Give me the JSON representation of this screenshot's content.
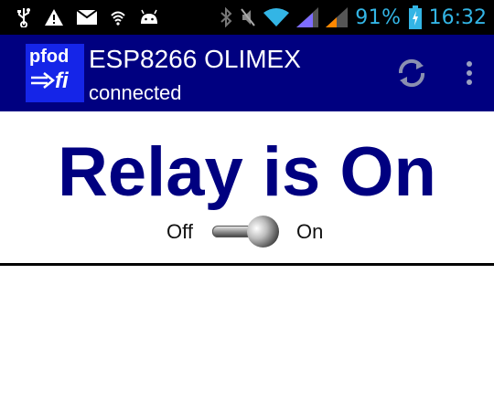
{
  "status_bar": {
    "icons": [
      "usb-icon",
      "warning-icon",
      "email-icon",
      "wifi-small-icon",
      "android-icon",
      "bluetooth-icon",
      "mute-icon",
      "wifi-icon",
      "signal-bar-purple-icon",
      "signal-bar-orange-icon",
      "battery-charging-icon"
    ],
    "battery_percent": "91%",
    "time": "16:32"
  },
  "app_bar": {
    "logo_top": "pfod",
    "logo_bottom": "fi",
    "title": "ESP8266 OLIMEX",
    "subtitle": "connected",
    "refresh_icon": "refresh-icon",
    "overflow_icon": "overflow-menu-icon"
  },
  "main": {
    "headline": "Relay is On",
    "switch": {
      "off_label": "Off",
      "on_label": "On",
      "state": "on"
    }
  },
  "colors": {
    "action_bar": "#000080",
    "headline": "#000080",
    "logo_bg": "#1525e8",
    "status_accent": "#33b5e5"
  }
}
